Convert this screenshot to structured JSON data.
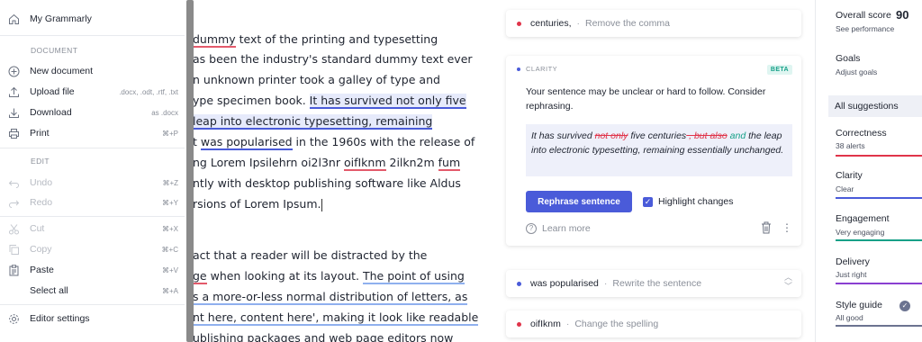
{
  "menu": {
    "my_grammarly": "My Grammarly",
    "document_header": "DOCUMENT",
    "new_document": "New document",
    "upload_file": "Upload file",
    "upload_formats": ".docx, .odt, .rtf, .txt",
    "download": "Download",
    "download_format": "as .docx",
    "print": "Print",
    "print_shortcut": "⌘+P",
    "edit_header": "EDIT",
    "undo": "Undo",
    "undo_shortcut": "⌘+Z",
    "redo": "Redo",
    "redo_shortcut": "⌘+Y",
    "cut": "Cut",
    "cut_shortcut": "⌘+X",
    "copy": "Copy",
    "copy_shortcut": "⌘+C",
    "paste": "Paste",
    "paste_shortcut": "⌘+V",
    "select_all": "Select all",
    "select_all_shortcut": "⌘+A",
    "editor_settings": "Editor settings"
  },
  "editor": {
    "l1_a": "dummy",
    "l1_b": " text of the printing and typesetting",
    "l2": "as been the industry's standard dummy text ever",
    "l3": "n unknown printer took a galley of type and",
    "l4_a": "ype specimen book. ",
    "l4_b": "It has survived not only five",
    "l5_a": "leap into electronic typesetting, remaining",
    "l6_a": "t ",
    "l6_b": "was popularised",
    "l6_c": " in the 1960s with the release of",
    "l7_a": "ng Lorem Ipsilehrn oi2l3nr ",
    "l7_b": "oifIknm",
    "l7_c": " 2ilkn2m ",
    "l7_d": "fum",
    "l8": "ntly with desktop publishing software like Aldus",
    "l9": "rsions of Lorem Ipsum.",
    "l10": "act that a reader will be distracted by the",
    "l11_a": "ge",
    "l11_b": " when looking at its layout. ",
    "l11_c": "The point of using",
    "l12": "s a more-or-less normal distribution of letters, as",
    "l13": "nt here, content here', making it look like readable",
    "l14": "ublishing packages and web page editors now"
  },
  "cards": {
    "c1_term": "centuries,",
    "c1_sep": "·",
    "c1_action": "Remove the comma",
    "clarity_label": "CLARITY",
    "beta": "BETA",
    "clarity_desc": "Your sentence may be unclear or hard to follow. Consider rephrasing.",
    "ex_1": "It has survived ",
    "ex_del1": "not only",
    "ex_2": " five centuries",
    "ex_del2": " , but also",
    "ex_3": " ",
    "ex_ins": "and",
    "ex_4": " the leap into electronic typesetting, remaining essentially unchanged.",
    "rephrase_button": "Rephrase sentence",
    "highlight_changes": "Highlight changes",
    "learn_more": "Learn more",
    "c3_term": "was popularised",
    "c3_sep": "·",
    "c3_action": "Rewrite the sentence",
    "c4_term": "oifIknm",
    "c4_sep": "·",
    "c4_action": "Change the spelling"
  },
  "sidebar": {
    "overall_score_label": "Overall score",
    "overall_score": "90",
    "see_performance": "See performance",
    "goals": "Goals",
    "adjust_goals": "Adjust goals",
    "all_suggestions": "All suggestions",
    "correctness": "Correctness",
    "correctness_sub": "38 alerts",
    "clarity": "Clarity",
    "clarity_sub": "Clear",
    "engagement": "Engagement",
    "engagement_sub": "Very engaging",
    "delivery": "Delivery",
    "delivery_sub": "Just right",
    "style_guide": "Style guide",
    "style_guide_sub": "All good"
  },
  "colors": {
    "correctness": "#e0344a",
    "clarity": "#4a5bd9",
    "engagement": "#16a088",
    "delivery": "#8a3fd1",
    "style_guide": "#6b7390"
  }
}
